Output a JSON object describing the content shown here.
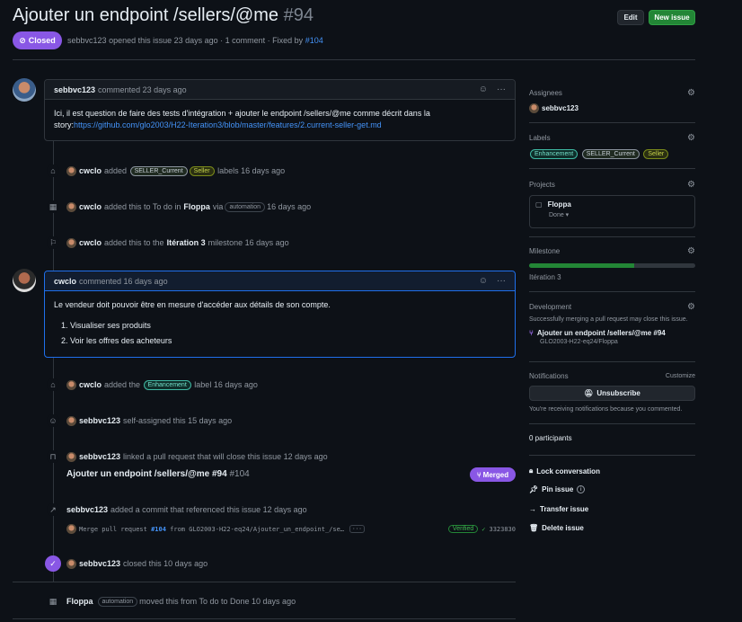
{
  "issue": {
    "title": "Ajouter un endpoint /sellers/@me",
    "number": "#94",
    "state": "Closed",
    "author": "sebbvc123",
    "opened_text": "opened this issue 23 days ago · 1 comment · Fixed by",
    "fixed_by": "#104"
  },
  "header": {
    "edit_label": "Edit",
    "new_issue_label": "New issue"
  },
  "comments": [
    {
      "author": "sebbvc123",
      "time": "commented 23 days ago",
      "body_text": "Ici, il est question de faire des tests d'intégration + ajouter le endpoint /sellers/@me comme décrit dans la story:",
      "link": "https://github.com/glo2003/H22-Iteration3/blob/master/features/2.current-seller-get.md"
    },
    {
      "author": "cwclo",
      "time": "commented 16 days ago",
      "body_text": "Le vendeur doit pouvoir être en mesure d'accéder aux détails de son compte.",
      "list": [
        "Visualiser ses produits",
        "Voir les offres des acheteurs"
      ]
    }
  ],
  "events": {
    "labels_added": {
      "actor": "cwclo",
      "pre": "added",
      "labels": [
        "SELLER_Current",
        "Seller"
      ],
      "post": "labels 16 days ago"
    },
    "project_added": {
      "actor": "cwclo",
      "pre": "added this to To do in",
      "project": "Floppa",
      "via": "via",
      "pill": "automation",
      "post": "16 days ago"
    },
    "milestone_added": {
      "actor": "cwclo",
      "pre": "added this to the",
      "milestone": "Itération 3",
      "post": "milestone 16 days ago"
    },
    "label_enh": {
      "actor": "cwclo",
      "pre": "added the",
      "label": "Enhancement",
      "post": "label 16 days ago"
    },
    "self_assigned": {
      "actor": "sebbvc123",
      "text": "self-assigned this 15 days ago"
    },
    "linked_pr": {
      "actor": "sebbvc123",
      "text": "linked a pull request that will close this issue 12 days ago",
      "pr_title": "Ajouter un endpoint /sellers/@me #94",
      "pr_number": "#104",
      "pr_state": "Merged"
    },
    "commit_ref": {
      "actor": "sebbvc123",
      "text": "added a commit that referenced this issue 12 days ago",
      "commit_msg_pre": "Merge pull request",
      "commit_pr": "#104",
      "commit_msg_post": "from GLO2003-H22-eq24/Ajouter_un_endpoint_/se…",
      "ellipsis": "···",
      "verified": "Verified",
      "sha": "3323830"
    },
    "closed": {
      "actor": "sebbvc123",
      "text": "closed this 10 days ago"
    },
    "moved": {
      "actor": "Floppa",
      "pill": "automation",
      "text": "moved this from To do to Done 10 days ago"
    }
  },
  "sidebar": {
    "assignees": {
      "heading": "Assignees",
      "user": "sebbvc123"
    },
    "labels": {
      "heading": "Labels",
      "items": [
        "Enhancement",
        "SELLER_Current",
        "Seller"
      ]
    },
    "projects": {
      "heading": "Projects",
      "name": "Floppa",
      "status": "Done ▾"
    },
    "milestone": {
      "heading": "Milestone",
      "name": "Itération 3",
      "progress": 0.63
    },
    "development": {
      "heading": "Development",
      "note": "Successfully merging a pull request may close this issue.",
      "pr_title": "Ajouter un endpoint /sellers/@me #94",
      "pr_repo": "GLO2003-H22-eq24/Floppa"
    },
    "notifications": {
      "heading": "Notifications",
      "customize": "Customize",
      "button": "Unsubscribe",
      "note": "You're receiving notifications because you commented."
    },
    "participants": "0 participants",
    "actions": {
      "lock": "Lock conversation",
      "pin": "Pin issue",
      "transfer": "Transfer issue",
      "delete": "Delete issue"
    }
  },
  "colors": {
    "closed": "#8957e5",
    "accent": "#4493f8",
    "new_issue": "#238636"
  }
}
